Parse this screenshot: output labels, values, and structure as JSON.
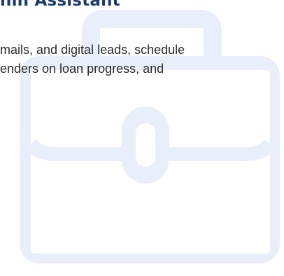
{
  "card": {
    "title": "hin Assistant",
    "description_lines": [
      "mails, and digital leads, schedule",
      "enders on loan progress, and"
    ],
    "background_icon": "briefcase-icon"
  },
  "colors": {
    "title": "#1b3b6f",
    "text": "#2a2a2a",
    "icon": "#e9effa"
  }
}
